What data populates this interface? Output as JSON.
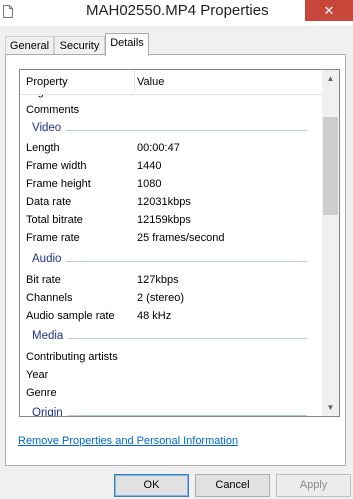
{
  "window": {
    "title": "MAH02550.MP4 Properties",
    "close_glyph": "✕"
  },
  "tabs": [
    {
      "label": "General"
    },
    {
      "label": "Security"
    },
    {
      "label": "Details"
    }
  ],
  "list": {
    "header": {
      "property": "Property",
      "value": "Value"
    },
    "partial_top": "Tags",
    "comments": "Comments",
    "groups": {
      "video": "Video",
      "audio": "Audio",
      "media": "Media",
      "origin": "Origin"
    },
    "video": [
      {
        "label": "Length",
        "value": "00:00:47"
      },
      {
        "label": "Frame width",
        "value": "1440"
      },
      {
        "label": "Frame height",
        "value": "1080"
      },
      {
        "label": "Data rate",
        "value": "12031kbps"
      },
      {
        "label": "Total bitrate",
        "value": "12159kbps"
      },
      {
        "label": "Frame rate",
        "value": "25 frames/second"
      }
    ],
    "audio": [
      {
        "label": "Bit rate",
        "value": "127kbps"
      },
      {
        "label": "Channels",
        "value": "2 (stereo)"
      },
      {
        "label": "Audio sample rate",
        "value": "48 kHz"
      }
    ],
    "media": [
      {
        "label": "Contributing artists",
        "value": ""
      },
      {
        "label": "Year",
        "value": ""
      },
      {
        "label": "Genre",
        "value": ""
      }
    ]
  },
  "link": "Remove Properties and Personal Information",
  "buttons": {
    "ok": "OK",
    "cancel": "Cancel",
    "apply": "Apply"
  },
  "icons": {
    "file": "file-icon",
    "up": "▲",
    "down": "▼"
  }
}
